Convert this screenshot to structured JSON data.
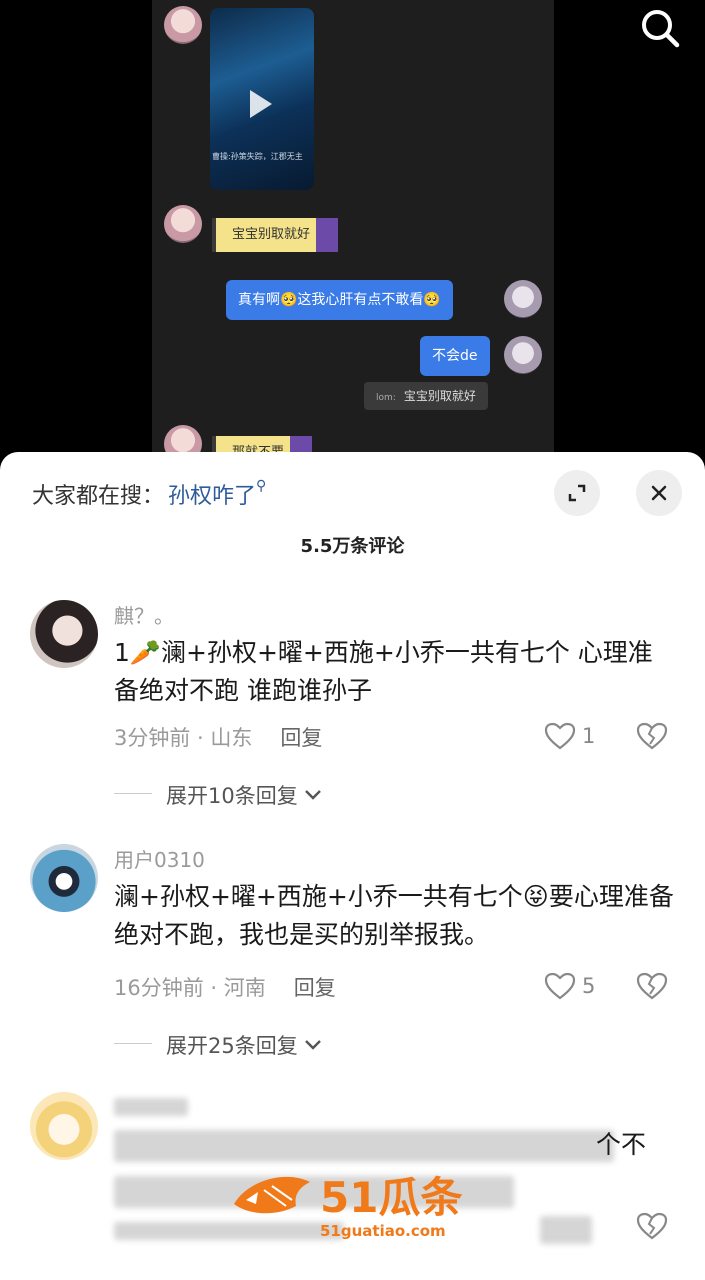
{
  "video": {
    "thumb_caption": "曹操:孙策失踪，江郡无主",
    "pixel_bubble_1": "宝宝别取就好",
    "pixel_bubble_2": "那就不要",
    "blue_bubble_1": "真有啊🥺这我心肝有点不敢看🥺",
    "blue_bubble_2": "不会de",
    "quote_tag": "lom:",
    "quote_text": "宝宝别取就好"
  },
  "sheet": {
    "hot_search_label": "大家都在搜：",
    "hot_search_keyword": "孙权咋了",
    "comment_count": "5.5万条评论"
  },
  "comments": [
    {
      "user": "麒？。",
      "text": "1🥕澜+孙权+曜+西施+小乔一共有七个 心理准备绝对不跑 谁跑谁孙子",
      "time": "3分钟前 · 山东",
      "reply": "回复",
      "likes": "1",
      "expand": "展开10条回复"
    },
    {
      "user": "用户0310",
      "text": "澜+孙权+曜+西施+小乔一共有七个😝要心理准备绝对不跑，我也是买的别举报我。",
      "time": "16分钟前 · 河南",
      "reply": "回复",
      "likes": "5",
      "expand": "展开25条回复"
    },
    {
      "visible_text_tail": "个不"
    }
  ],
  "watermark": {
    "brand": "51瓜条",
    "url": "51guatiao.com"
  },
  "colors": {
    "accent_blue": "#2e5c9a",
    "bubble_blue": "#3a7be8",
    "watermark_orange": "#f07a1a"
  }
}
